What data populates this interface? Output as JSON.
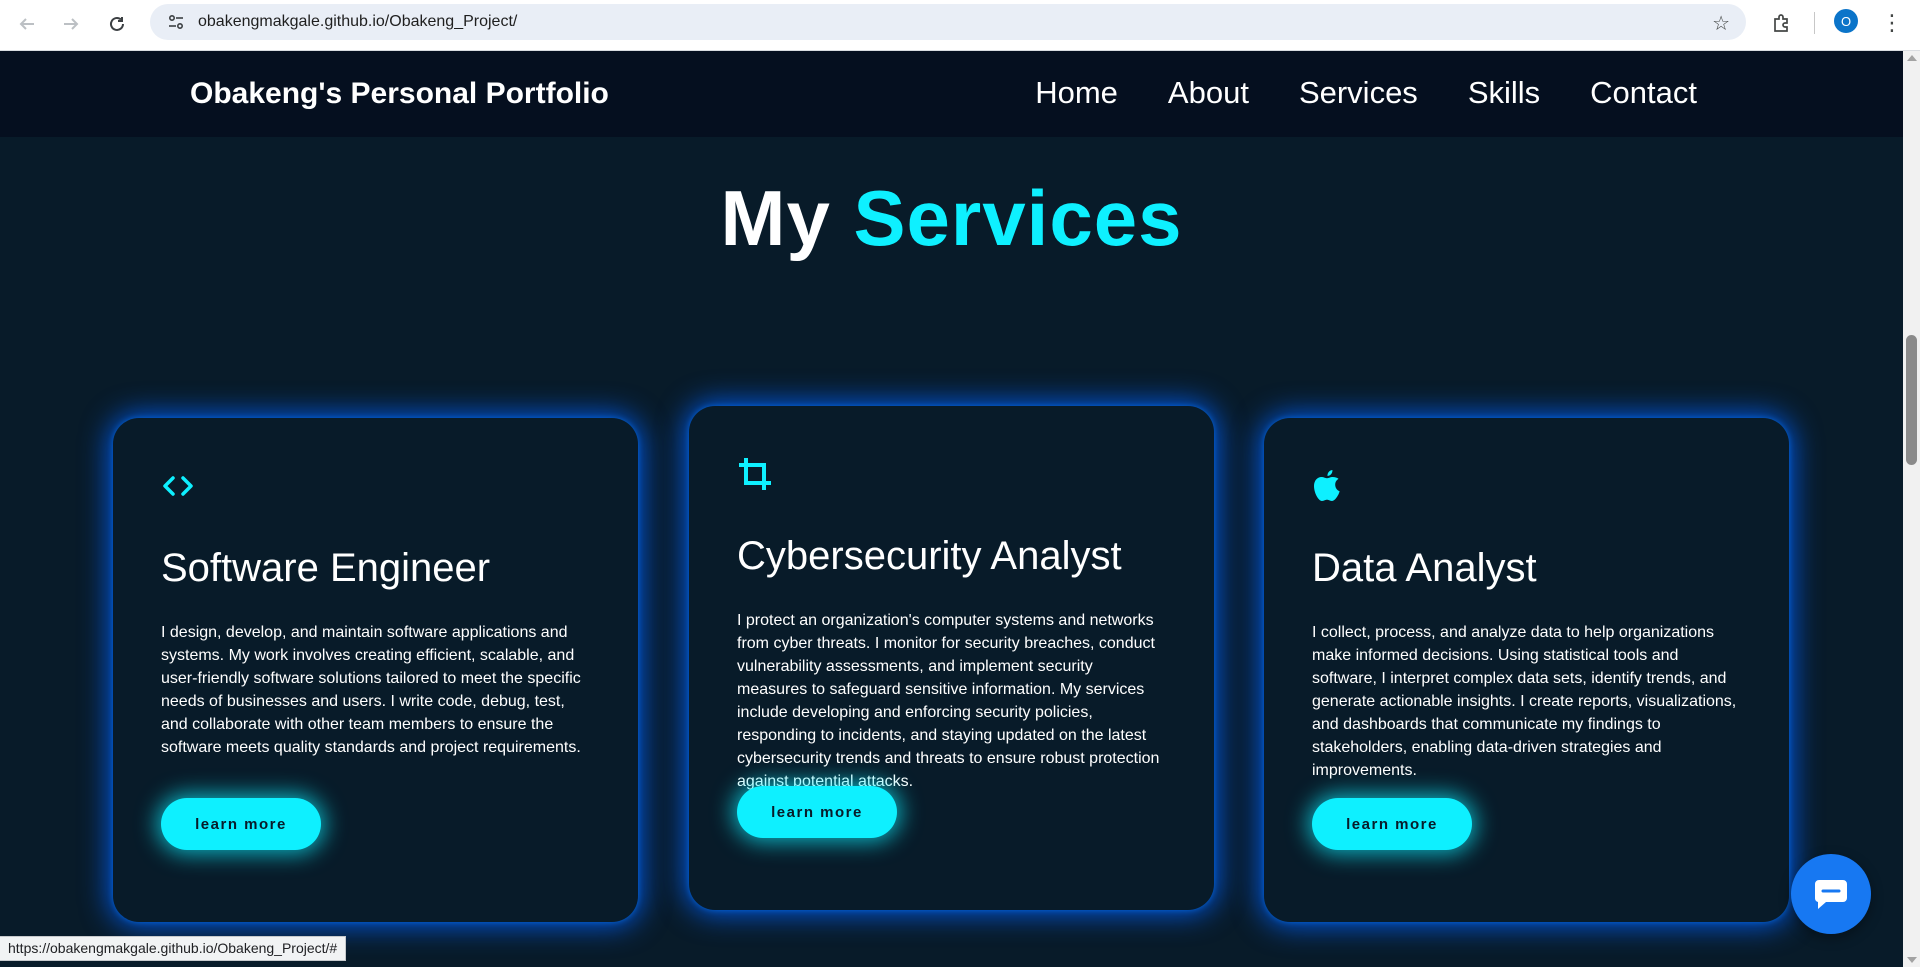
{
  "browser": {
    "url": "obakengmakgale.github.io/Obakeng_Project/",
    "profile_initial": "O",
    "status_url": "https://obakengmakgale.github.io/Obakeng_Project/#"
  },
  "site": {
    "logo": "Obakeng's Personal Portfolio",
    "nav": [
      "Home",
      "About",
      "Services",
      "Skills",
      "Contact"
    ]
  },
  "services_section": {
    "title_prefix": "My",
    "title_accent": "Services",
    "accent_color": "#0ef0ff",
    "cards": [
      {
        "icon": "code-icon",
        "title": "Software Engineer",
        "description": "I design, develop, and maintain software applications and systems. My work involves creating efficient, scalable, and user-friendly software solutions tailored to meet the specific needs of businesses and users. I write code, debug, test, and collaborate with other team members to ensure the software meets quality standards and project requirements.",
        "button": "learn more"
      },
      {
        "icon": "crop-icon",
        "title": "Cybersecurity Analyst",
        "description": "I protect an organization's computer systems and networks from cyber threats. I monitor for security breaches, conduct vulnerability assessments, and implement security measures to safeguard sensitive information. My services include developing and enforcing security policies, responding to incidents, and staying updated on the latest cybersecurity trends and threats to ensure robust protection against potential attacks.",
        "button": "learn more"
      },
      {
        "icon": "apple-icon",
        "title": "Data Analyst",
        "description": "I collect, process, and analyze data to help organizations make informed decisions. Using statistical tools and software, I interpret complex data sets, identify trends, and generate actionable insights. I create reports, visualizations, and dashboards that communicate my findings to stakeholders, enabling data-driven strategies and improvements.",
        "button": "learn more"
      }
    ]
  }
}
